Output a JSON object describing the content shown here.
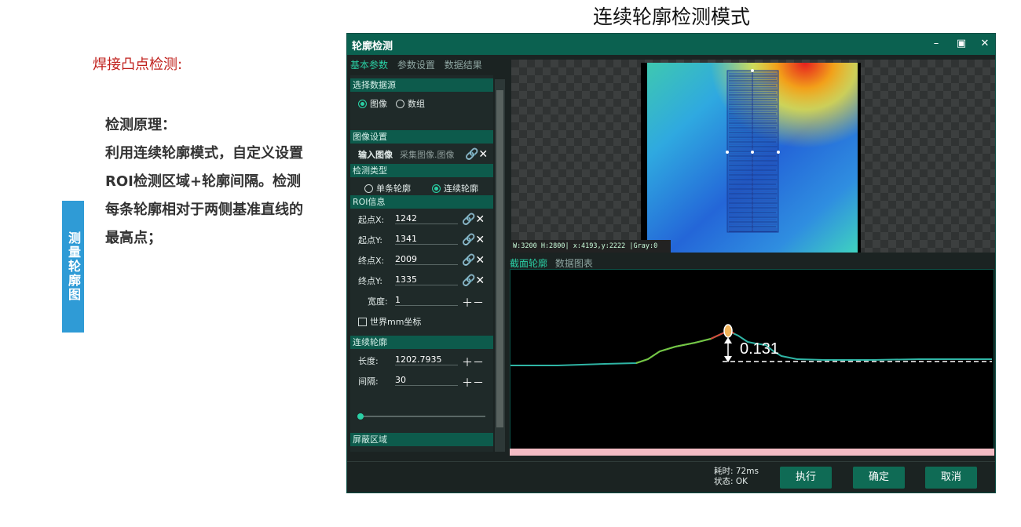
{
  "left": {
    "vertical_tab": "测量轮廓图",
    "section_title": "焊接凸点检测:",
    "principle_head": "检测原理：",
    "principle_body": "利用连续轮廓模式，自定义设置ROI检测区域+轮廓间隔。检测每条轮廓相对于两侧基准直线的最高点；"
  },
  "main_title": "连续轮廓检测模式",
  "window": {
    "title": "轮廓检测",
    "tabs": [
      "基本参数",
      "参数设置",
      "数据结果"
    ],
    "panel": {
      "select_source": "选择数据源",
      "source_image": "图像",
      "source_array": "数组",
      "image_settings": "图像设置",
      "input_image_label": "输入图像",
      "input_image_value": "采集图像.图像",
      "detect_type": "检测类型",
      "single_profile": "单条轮廓",
      "continuous_profile": "连续轮廓",
      "roi_info": "ROI信息",
      "start_x_label": "起点X:",
      "start_x": "1242",
      "start_y_label": "起点Y:",
      "start_y": "1341",
      "end_x_label": "终点X:",
      "end_x": "2009",
      "end_y_label": "终点Y:",
      "end_y": "1335",
      "width_label": "宽度:",
      "width": "1",
      "world_mm": "世界mm坐标",
      "cont_profile": "连续轮廓",
      "length_label": "长度:",
      "length": "1202.7935",
      "interval_label": "间隔:",
      "interval": "30",
      "mask_area": "屏蔽区域"
    },
    "status_text": "W:3200 H:2800| x:4193,y:2222 |Gray:0",
    "subtabs": [
      "截面轮廓",
      "数据图表"
    ],
    "measurement": "0.131",
    "time_text": "耗时: 72ms",
    "state_text": "状态: OK",
    "buttons": {
      "run": "执行",
      "ok": "确定",
      "cancel": "取消"
    },
    "window_btns": {
      "min": "–",
      "max": "▣",
      "close": "✕"
    }
  },
  "colors": {
    "accent": "#0b6150",
    "tab_active": "#2ad0a5",
    "title_red": "#c0201c",
    "side_tab": "#2f9bd6"
  }
}
